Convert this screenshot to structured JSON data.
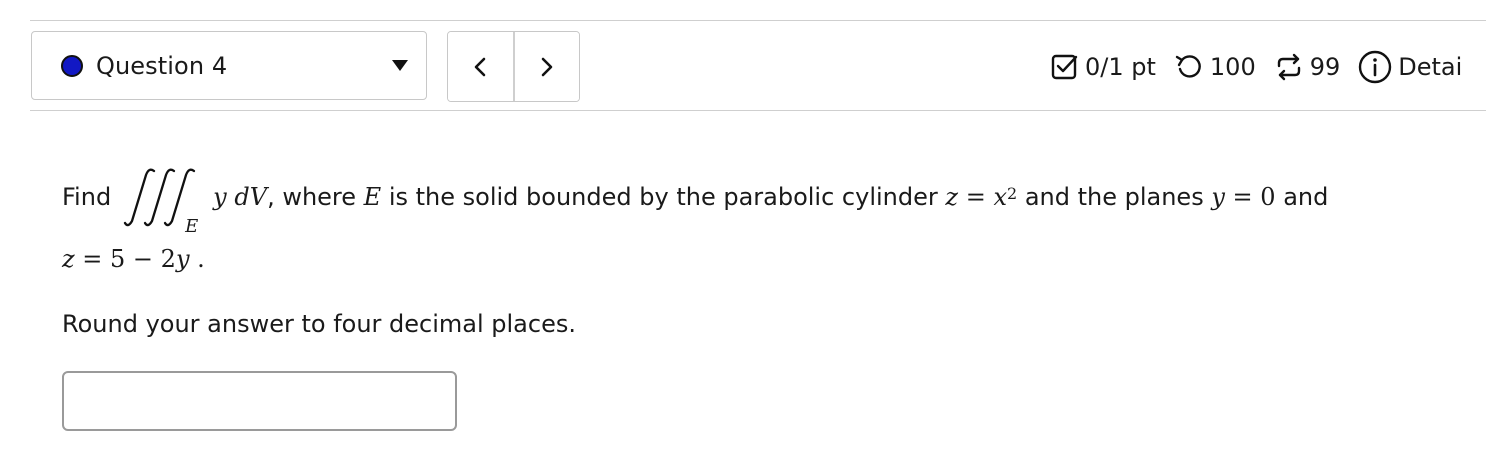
{
  "question_selector": {
    "label": "Question 4",
    "status_color": "#1218c4"
  },
  "nav": {
    "prev_icon": "chevron-left-icon",
    "next_icon": "chevron-right-icon"
  },
  "stats": {
    "score": "0/1 pt",
    "score_icon": "checkbox-icon",
    "attempts": "100",
    "attempts_icon": "undo-icon",
    "versions": "99",
    "versions_icon": "refresh-arrows-icon",
    "details": "Detai",
    "details_icon": "info-icon"
  },
  "question": {
    "find": "Find",
    "integrand": "y dV",
    "region_sub": "E",
    "where": ", where",
    "region": "E",
    "text_a": "is the solid bounded by the parabolic cylinder",
    "eq1_lhs": "z",
    "eq1_eq": "=",
    "eq1_rhs": "x",
    "eq1_exp": "2",
    "text_b": "and the planes",
    "eq2_lhs": "y",
    "eq2_eq": "=",
    "eq2_rhs": "0",
    "text_c": "and",
    "eq3_lhs": "z",
    "eq3_rest": "= 5 − 2",
    "eq3_var": "y",
    "eq3_end": "."
  },
  "instructions": "Round your answer to four decimal places.",
  "answer": {
    "value": "",
    "placeholder": ""
  }
}
